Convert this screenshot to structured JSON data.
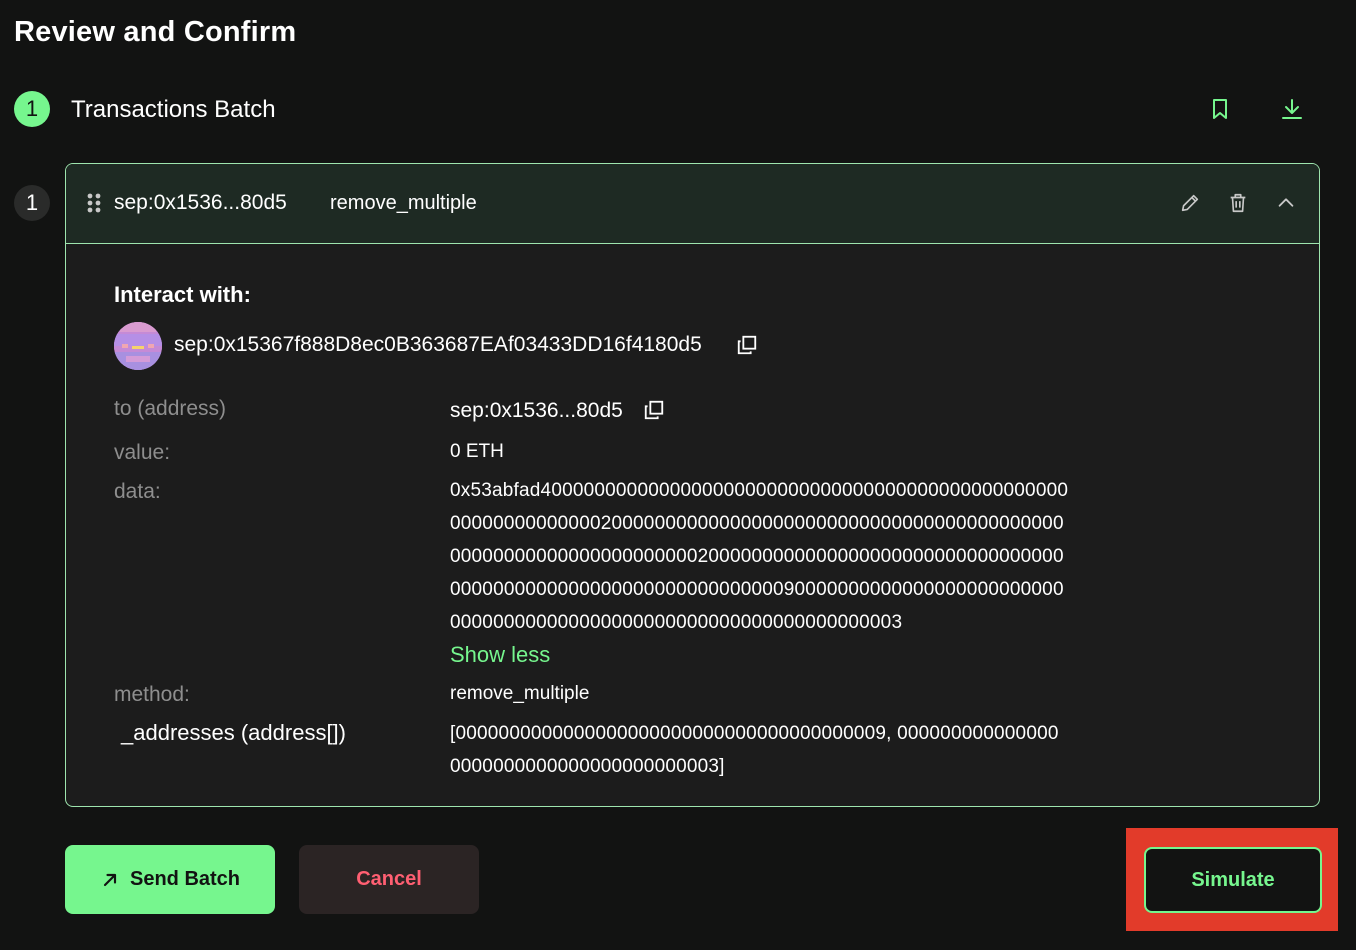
{
  "page": {
    "title": "Review and Confirm"
  },
  "step": {
    "number": "1",
    "title": "Transactions Batch"
  },
  "transaction": {
    "index": "1",
    "short_address": "sep:0x1536...80d5",
    "method_name": "remove_multiple",
    "interact_label": "Interact with:",
    "full_address": "sep:0x15367f888D8ec0B363687EAf03433DD16f4180d5",
    "fields": {
      "to_label": "to (address)",
      "to_value": "sep:0x1536...80d5",
      "value_label": "value:",
      "value_value": "0 ETH",
      "data_label": "data:",
      "data_lines": [
        "0x53abfad4000000000000000000000000000000000000000000000000",
        "000000000000002000000000000000000000000000000000000000000",
        "000000000000000000000002000000000000000000000000000000000",
        "000000000000000000000000000000090000000000000000000000000",
        "000000000000000000000000000000000000000003"
      ],
      "show_less": "Show less",
      "method_label": "method:",
      "method_value": "remove_multiple",
      "param_label": "_addresses (address[])",
      "param_lines": [
        "[0000000000000000000000000000000000000009, 000000000000000",
        "0000000000000000000000003]"
      ]
    }
  },
  "actions": {
    "send_batch": "Send Batch",
    "cancel": "Cancel",
    "simulate": "Simulate"
  },
  "colors": {
    "accent": "#76f68e",
    "danger": "#ff5f72",
    "highlight": "#e23b2a",
    "background": "#121312"
  },
  "icons": {
    "bookmark": "bookmark-icon",
    "download": "download-icon",
    "drag": "drag-handle-icon",
    "edit": "pencil-icon",
    "delete": "trash-icon",
    "collapse": "chevron-up-icon",
    "copy": "copy-icon",
    "arrow": "arrow-up-right-icon"
  }
}
